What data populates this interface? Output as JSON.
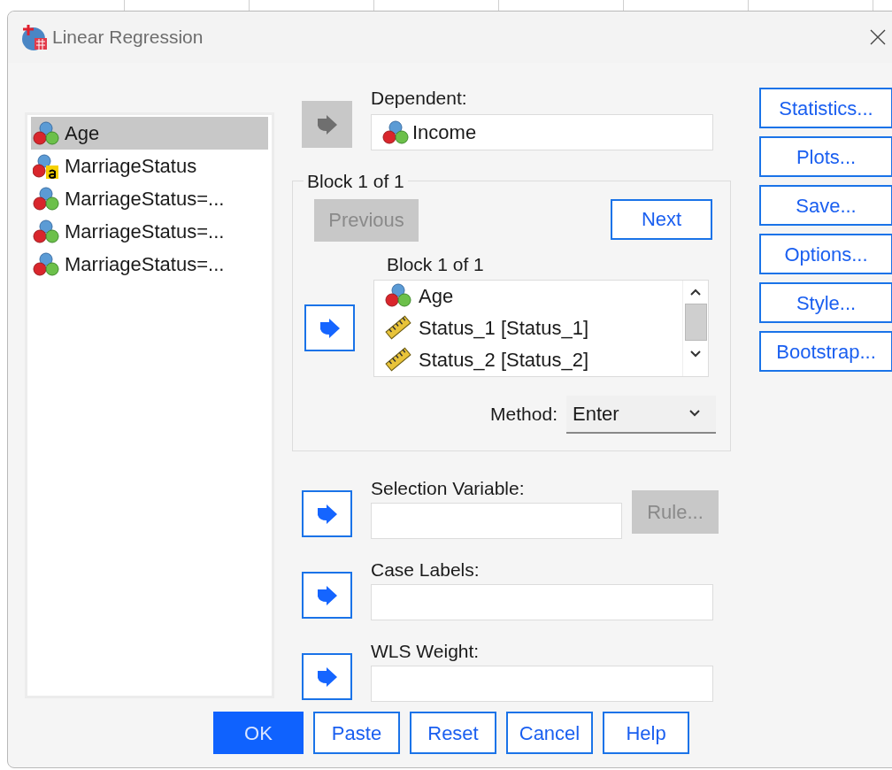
{
  "window": {
    "title": "Linear Regression"
  },
  "variables": [
    {
      "name": "Age",
      "kind": "scale",
      "selected": true
    },
    {
      "name": "MarriageStatus",
      "kind": "string",
      "selected": false
    },
    {
      "name": "MarriageStatus=...",
      "kind": "scale",
      "selected": false
    },
    {
      "name": "MarriageStatus=...",
      "kind": "scale",
      "selected": false
    },
    {
      "name": "MarriageStatus=...",
      "kind": "scale",
      "selected": false
    }
  ],
  "dependent": {
    "label": "Dependent:",
    "arrow_disabled": true,
    "value": {
      "name": "Income",
      "kind": "scale"
    }
  },
  "block": {
    "title": "Block 1 of 1",
    "previous": {
      "label": "Previous",
      "disabled": true
    },
    "next": {
      "label": "Next",
      "disabled": false
    },
    "list_label": "Block 1 of 1",
    "arrow_disabled": false,
    "items": [
      {
        "name": "Age",
        "kind": "scale"
      },
      {
        "name": "Status_1 [Status_1]",
        "kind": "ruler"
      },
      {
        "name": "Status_2 [Status_2]",
        "kind": "ruler"
      }
    ],
    "method": {
      "label": "Method:",
      "value": "Enter"
    }
  },
  "selection_variable": {
    "label": "Selection Variable:",
    "arrow_disabled": false,
    "rule": {
      "label": "Rule...",
      "disabled": true
    }
  },
  "case_labels": {
    "label": "Case Labels:",
    "arrow_disabled": false
  },
  "wls_weight": {
    "label": "WLS Weight:",
    "arrow_disabled": false
  },
  "side_buttons": [
    "Statistics...",
    "Plots...",
    "Save...",
    "Options...",
    "Style...",
    "Bootstrap..."
  ],
  "buttons": [
    {
      "label": "OK",
      "default": true
    },
    {
      "label": "Paste",
      "default": false
    },
    {
      "label": "Reset",
      "default": false
    },
    {
      "label": "Cancel",
      "default": false
    },
    {
      "label": "Help",
      "default": false
    }
  ]
}
